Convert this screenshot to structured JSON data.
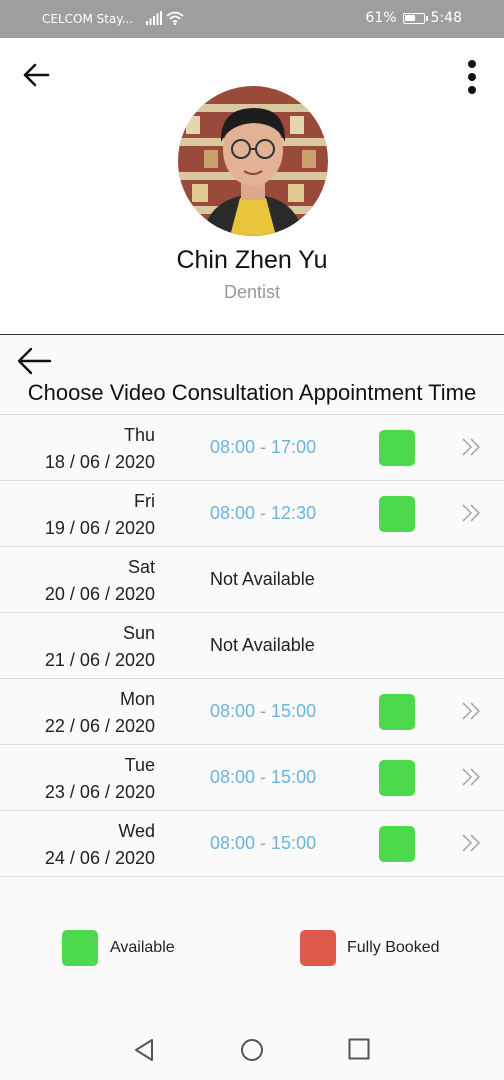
{
  "status_bar": {
    "carrier": "CELCOM Stay...",
    "battery_percent": "61%",
    "battery_level": 0.61,
    "time": "5:48"
  },
  "profile": {
    "name": "Chin Zhen Yu",
    "role": "Dentist"
  },
  "section": {
    "title": "Choose Video Consultation Appointment Time"
  },
  "slots": [
    {
      "day": "Thu",
      "date": "18 / 06 / 2020",
      "time": "08:00 - 17:00",
      "status": "available"
    },
    {
      "day": "Fri",
      "date": "19 / 06 / 2020",
      "time": "08:00 - 12:30",
      "status": "available"
    },
    {
      "day": "Sat",
      "date": "20 / 06 / 2020",
      "time": "Not Available",
      "status": "none"
    },
    {
      "day": "Sun",
      "date": "21 / 06 / 2020",
      "time": "Not Available",
      "status": "none"
    },
    {
      "day": "Mon",
      "date": "22 / 06 / 2020",
      "time": "08:00 - 15:00",
      "status": "available"
    },
    {
      "day": "Tue",
      "date": "23 / 06 / 2020",
      "time": "08:00 - 15:00",
      "status": "available"
    },
    {
      "day": "Wed",
      "date": "24 / 06 / 2020",
      "time": "08:00 - 15:00",
      "status": "available"
    }
  ],
  "legend": {
    "available_label": "Available",
    "booked_label": "Fully Booked"
  },
  "colors": {
    "available": "#4cd94c",
    "booked": "#e05a4c",
    "time_link": "#6ab3dc"
  },
  "icons": {
    "back": "arrow-left-icon",
    "menu": "more-vertical-icon",
    "slot_arrow": "double-chevron-right-icon",
    "nav_back": "triangle-back-icon",
    "nav_home": "circle-home-icon",
    "nav_recents": "square-recents-icon"
  }
}
